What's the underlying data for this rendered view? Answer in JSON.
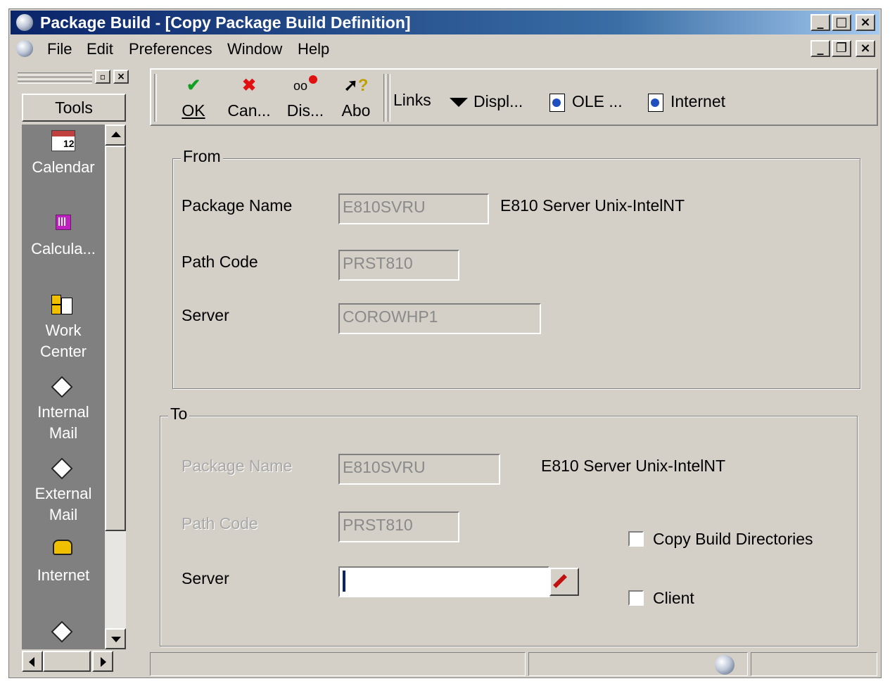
{
  "window": {
    "title": "Package Build - [Copy Package Build Definition]",
    "caption_buttons": [
      "minimize",
      "maximize",
      "close"
    ],
    "mdi_buttons": [
      "minimize",
      "restore",
      "close"
    ]
  },
  "menu": {
    "items": [
      "File",
      "Edit",
      "Preferences",
      "Window",
      "Help"
    ]
  },
  "tools_panel": {
    "header": "Tools",
    "items": [
      {
        "line1": "Calendar",
        "line2": "",
        "icon": "calendar-icon"
      },
      {
        "line1": "Calcula...",
        "line2": "",
        "icon": "calculator-icon"
      },
      {
        "line1": "Work",
        "line2": "Center",
        "icon": "work-center-icon"
      },
      {
        "line1": "Internal",
        "line2": "Mail",
        "icon": "mail-icon"
      },
      {
        "line1": "External",
        "line2": "Mail",
        "icon": "mail-icon"
      },
      {
        "line1": "Internet",
        "line2": "",
        "icon": "telephone-icon"
      },
      {
        "line1": "",
        "line2": "",
        "icon": "mail-icon"
      }
    ]
  },
  "toolbar": {
    "ok": "OK",
    "cancel": "Can...",
    "display": "Dis...",
    "about": "Abo",
    "links": "Links",
    "display_menu": "Displ...",
    "ole": "OLE ...",
    "internet": "Internet"
  },
  "from": {
    "legend": "From",
    "package_name_label": "Package Name",
    "package_name_value": "E810SVRU",
    "package_description": "E810 Server Unix-IntelNT",
    "path_code_label": "Path Code",
    "path_code_value": "PRST810",
    "server_label": "Server",
    "server_value": "COROWHP1"
  },
  "to": {
    "legend": "To",
    "package_name_label": "Package Name",
    "package_name_value": "E810SVRU",
    "package_description": "E810 Server Unix-IntelNT",
    "path_code_label": "Path Code",
    "path_code_value": "PRST810",
    "server_label": "Server",
    "server_value": "",
    "copy_build_dirs_label": "Copy Build Directories",
    "copy_build_dirs_checked": false,
    "client_label": "Client",
    "client_checked": false
  },
  "colors": {
    "face": "#d4d0c8",
    "title_start": "#0a246a",
    "tools_bg": "#808080"
  }
}
